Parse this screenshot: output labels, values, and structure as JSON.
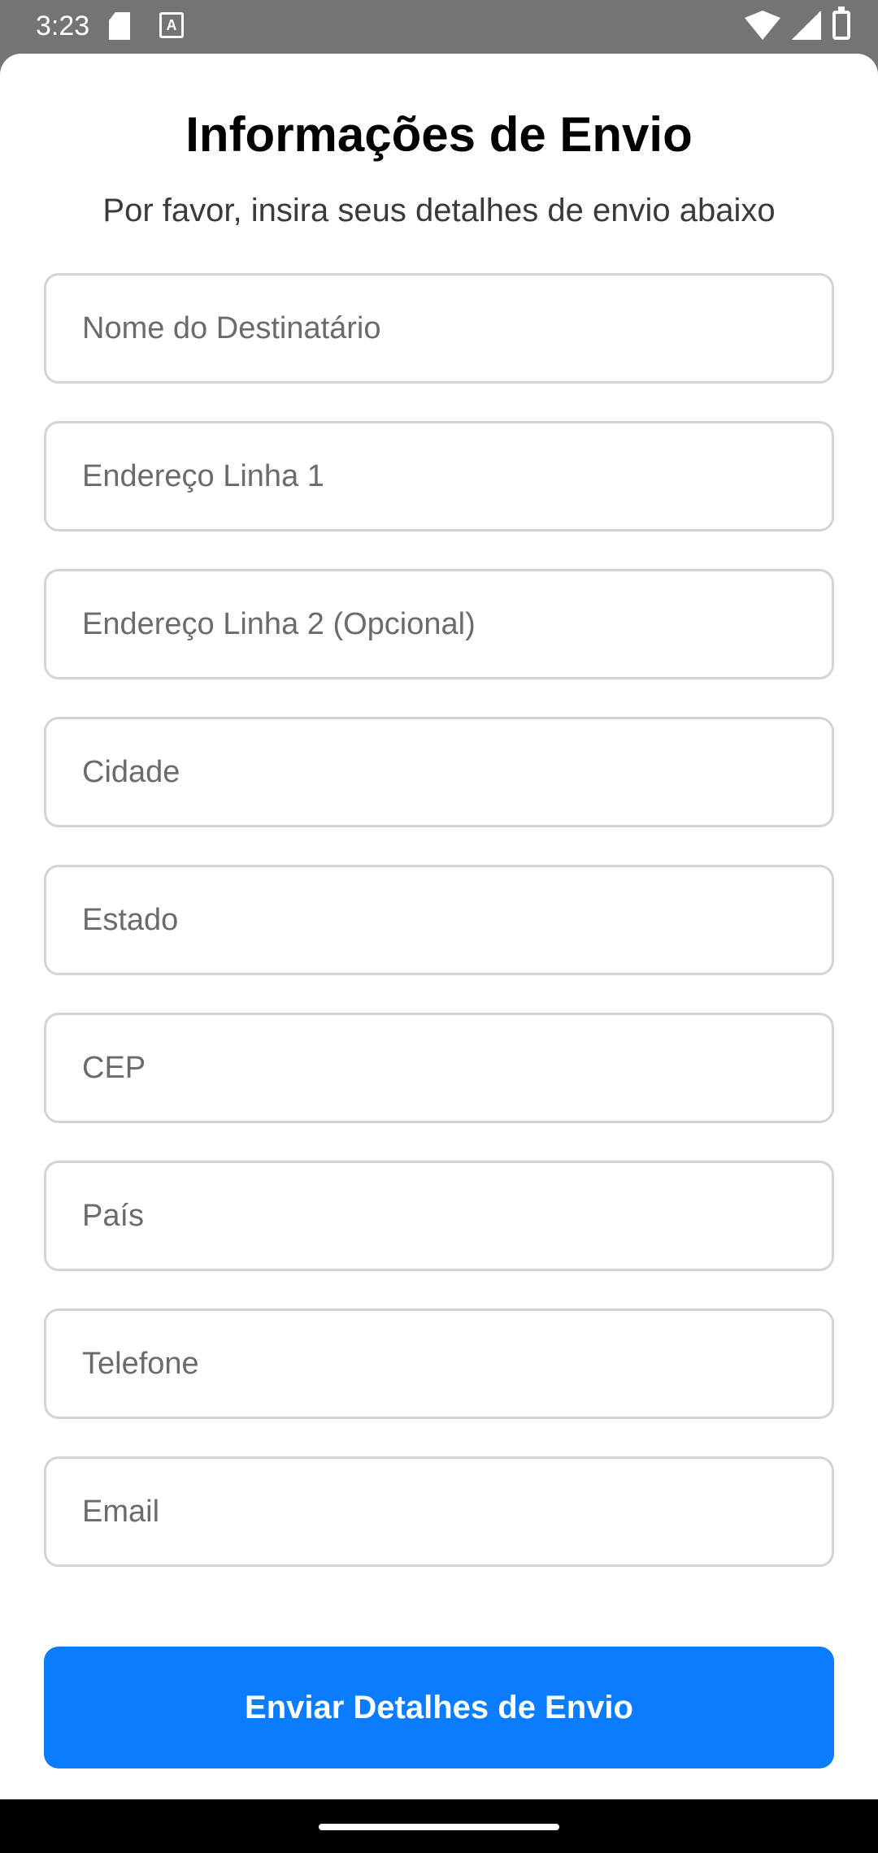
{
  "status_bar": {
    "time": "3:23",
    "left_icons": [
      "sd-card-icon",
      "keyboard-a-icon"
    ],
    "right_icons": [
      "wifi-icon",
      "signal-icon",
      "battery-icon"
    ]
  },
  "form": {
    "title": "Informações de Envio",
    "subtitle": "Por favor, insira seus detalhes de envio abaixo",
    "fields": [
      {
        "name": "recipient-name-field",
        "placeholder": "Nome do Destinatário",
        "value": ""
      },
      {
        "name": "address-line1-field",
        "placeholder": "Endereço Linha 1",
        "value": ""
      },
      {
        "name": "address-line2-field",
        "placeholder": "Endereço Linha 2 (Opcional)",
        "value": ""
      },
      {
        "name": "city-field",
        "placeholder": "Cidade",
        "value": ""
      },
      {
        "name": "state-field",
        "placeholder": "Estado",
        "value": ""
      },
      {
        "name": "zip-field",
        "placeholder": "CEP",
        "value": ""
      },
      {
        "name": "country-field",
        "placeholder": "País",
        "value": ""
      },
      {
        "name": "phone-field",
        "placeholder": "Telefone",
        "value": ""
      },
      {
        "name": "email-field",
        "placeholder": "Email",
        "value": ""
      }
    ],
    "submit_label": "Enviar Detalhes de Envio"
  },
  "colors": {
    "accent": "#0a7cff",
    "status_bar": "#747474",
    "field_border": "#d3d3d3"
  }
}
